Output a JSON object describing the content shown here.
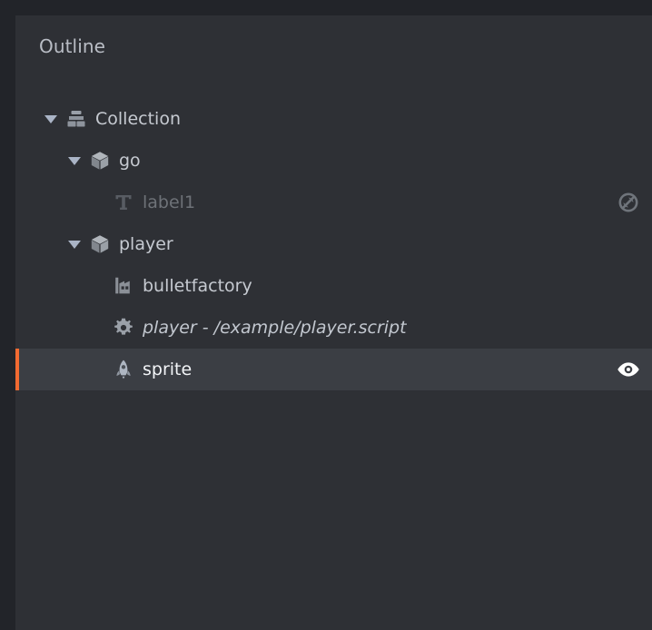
{
  "panel": {
    "title": "Outline",
    "background": "#2e3035",
    "outer_background": "#222429",
    "selection_background": "#3b3e44",
    "selection_marker_color": "#f26a31"
  },
  "tree": {
    "nodes": [
      {
        "label": "Collection",
        "icon": "collection-icon",
        "depth": 0,
        "expanded": true,
        "has_twisty": true,
        "dimmed": false,
        "italic": false,
        "selected": false,
        "visibility_icon": ""
      },
      {
        "label": "go",
        "icon": "game-object-cube-icon",
        "depth": 1,
        "expanded": true,
        "has_twisty": true,
        "dimmed": false,
        "italic": false,
        "selected": false,
        "visibility_icon": ""
      },
      {
        "label": "label1",
        "icon": "label-text-icon",
        "depth": 2,
        "expanded": false,
        "has_twisty": false,
        "dimmed": true,
        "italic": false,
        "selected": false,
        "visibility_icon": "eye-off-icon"
      },
      {
        "label": "player",
        "icon": "game-object-cube-icon",
        "depth": 1,
        "expanded": true,
        "has_twisty": true,
        "dimmed": false,
        "italic": false,
        "selected": false,
        "visibility_icon": ""
      },
      {
        "label": "bulletfactory",
        "icon": "factory-icon",
        "depth": 2,
        "expanded": false,
        "has_twisty": false,
        "dimmed": false,
        "italic": false,
        "selected": false,
        "visibility_icon": ""
      },
      {
        "label": "player - /example/player.script",
        "icon": "script-gear-icon",
        "depth": 2,
        "expanded": false,
        "has_twisty": false,
        "dimmed": false,
        "italic": true,
        "selected": false,
        "visibility_icon": ""
      },
      {
        "label": "sprite",
        "icon": "sprite-rocket-icon",
        "depth": 2,
        "expanded": false,
        "has_twisty": false,
        "dimmed": false,
        "italic": false,
        "selected": true,
        "visibility_icon": "eye-on-icon"
      }
    ]
  }
}
